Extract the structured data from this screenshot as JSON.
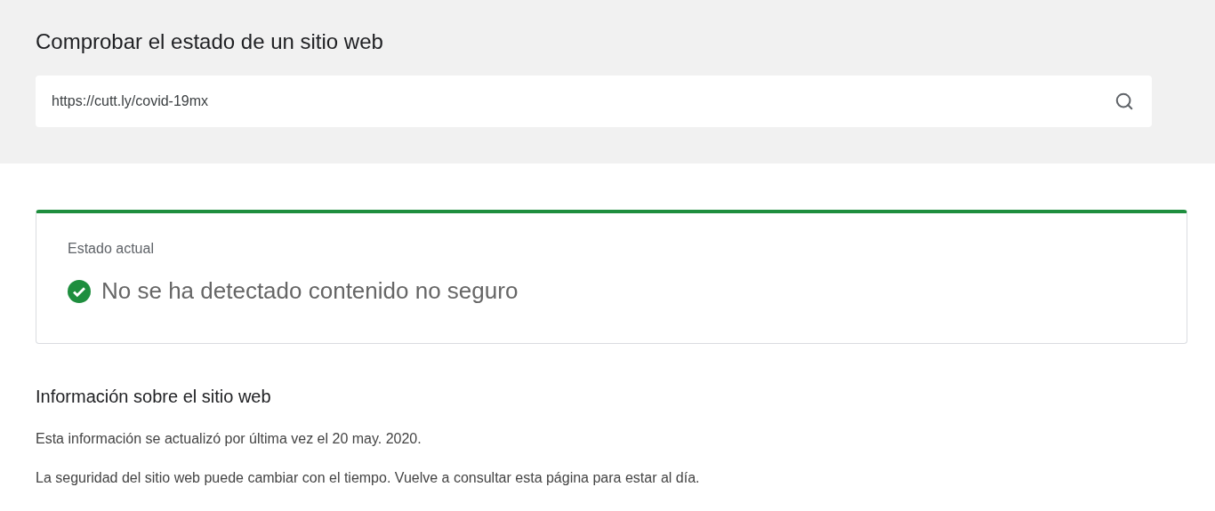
{
  "header": {
    "title": "Comprobar el estado de un sitio web"
  },
  "search": {
    "value": "https://cutt.ly/covid-19mx"
  },
  "status": {
    "label": "Estado actual",
    "kind": "safe",
    "text": "No se ha detectado contenido no seguro"
  },
  "info": {
    "title": "Información sobre el sitio web",
    "paragraphs": [
      "Esta información se actualizó por última vez el 20 may. 2020.",
      "La seguridad del sitio web puede cambiar con el tiempo. Vuelve a consultar esta página para estar al día."
    ]
  }
}
